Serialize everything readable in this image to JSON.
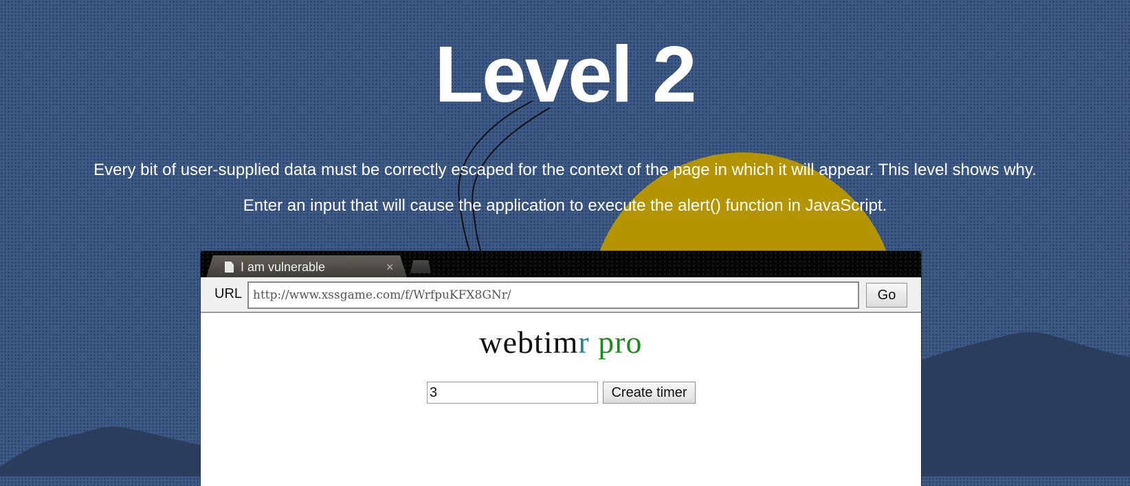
{
  "page": {
    "title": "Level 2",
    "description_1": "Every bit of user-supplied data must be correctly escaped for the context of the page in which it will appear. This level shows why.",
    "description_2": "Enter an input that will cause the application to execute the alert() function in JavaScript."
  },
  "browser": {
    "tab": {
      "label": "I am vulnerable",
      "close_glyph": "×",
      "icon": "document-icon"
    },
    "new_tab_icon": "new-tab-icon",
    "url_label": "URL",
    "url_value": "http://www.xssgame.com/f/WrfpuKFX8GNr/",
    "go_label": "Go"
  },
  "app": {
    "title_part1": "webtim",
    "title_part2": "r",
    "title_part3": " pro",
    "timer_value": "3",
    "create_label": "Create timer"
  },
  "colors": {
    "background": "#3d5a87",
    "sun": "#b49400",
    "mountains": "#2b3d5c",
    "title_teal": "#1f8a8a",
    "title_green": "#1d8a1d"
  }
}
